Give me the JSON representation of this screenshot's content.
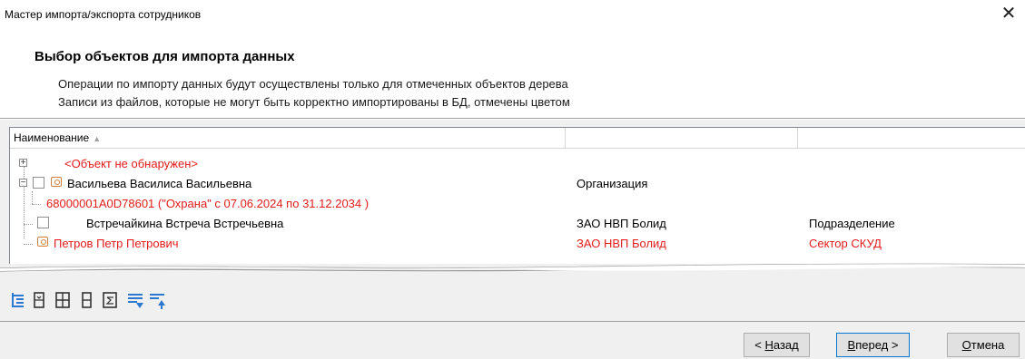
{
  "window": {
    "title": "Мастер импорта/экспорта сотрудников",
    "close_glyph": "✕"
  },
  "header": {
    "title": "Выбор объектов для импорта данных",
    "line1": "Операции по импорту данных будут осуществлены только для отмеченных объектов дерева",
    "line2": "Записи из файлов, которые не могут быть корректно импортированы в БД, отмечены цветом"
  },
  "tree": {
    "columns": [
      "Наименование",
      "",
      ""
    ],
    "sort_glyph": "▲",
    "rows": [
      {
        "name": "<Объект не обнаружен>",
        "col2": "",
        "col3": "",
        "red": true
      },
      {
        "name": "Васильева Василиса Васильевна",
        "col2": "Организация",
        "col3": "",
        "red": false
      },
      {
        "name": "68000001A0D78601 (\"Охрана\" с 07.06.2024  по 31.12.2034 )",
        "col2": "",
        "col3": "",
        "red": true
      },
      {
        "name": "Встречайкина Встреча Встречьевна",
        "col2": "ЗАО НВП Болид",
        "col3": "Подразделение",
        "red": false
      },
      {
        "name": "Петров Петр Петрович",
        "col2": "ЗАО НВП Болид",
        "col3": "Сектор СКУД",
        "red": true
      }
    ],
    "error_color": "#e31b1b"
  },
  "toolbar": {
    "icons": [
      "tree-view-icon",
      "collapse-all-icon",
      "expand-all-icon",
      "column-icon",
      "filter-sum-icon",
      "move-down-icon",
      "move-up-icon"
    ],
    "accent": "#2b78d0"
  },
  "buttons": {
    "back_hotkey": "Н",
    "back_rest": "азад",
    "back_prefix": "< ",
    "next_hotkey": "В",
    "next_rest": "перед",
    "next_suffix": " >",
    "cancel_hotkey": "О",
    "cancel_rest": "тмена"
  }
}
